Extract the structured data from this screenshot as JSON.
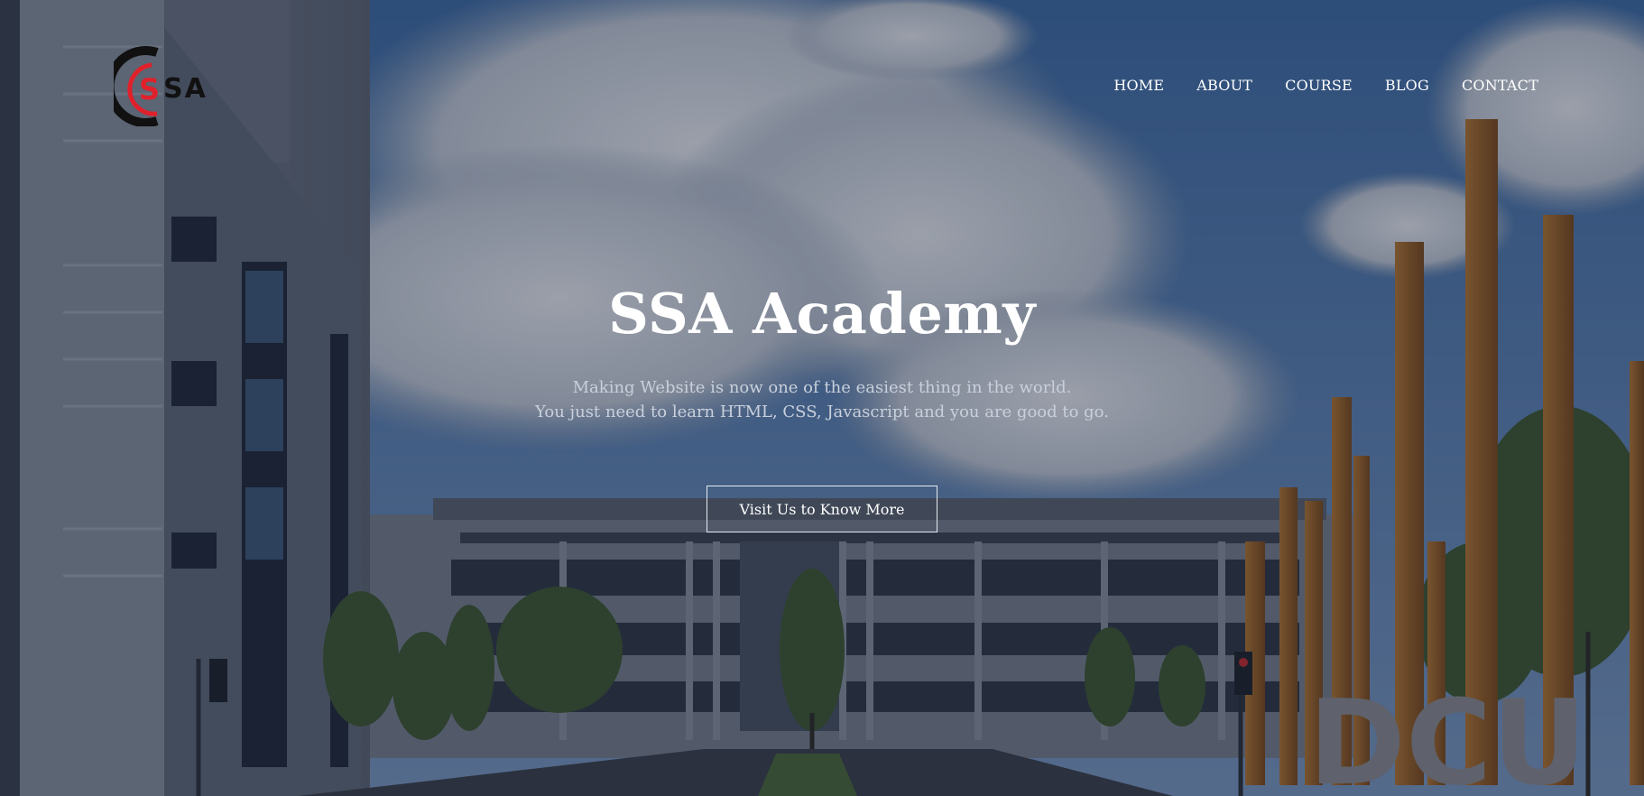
{
  "brand": {
    "logo_text": "SSA",
    "logo_ring_color": "#111111",
    "logo_accent_color": "#e0202a"
  },
  "nav": {
    "items": [
      {
        "label": "HOME"
      },
      {
        "label": "ABOUT"
      },
      {
        "label": "COURSE"
      },
      {
        "label": "BLOG"
      },
      {
        "label": "CONTACT"
      }
    ]
  },
  "hero": {
    "title": "SSA Academy",
    "subtitle_line1": "Making Website is now one of the easiest thing in the world.",
    "subtitle_line2": "You just need to learn HTML, CSS, Javascript and you are good to go.",
    "cta_label": "Visit Us to Know More",
    "background_sign": "DCU"
  },
  "colors": {
    "sky": "#3f6ea8",
    "overlay": "#121a30",
    "text": "#ffffff",
    "subtitle": "#c9d0dc"
  }
}
